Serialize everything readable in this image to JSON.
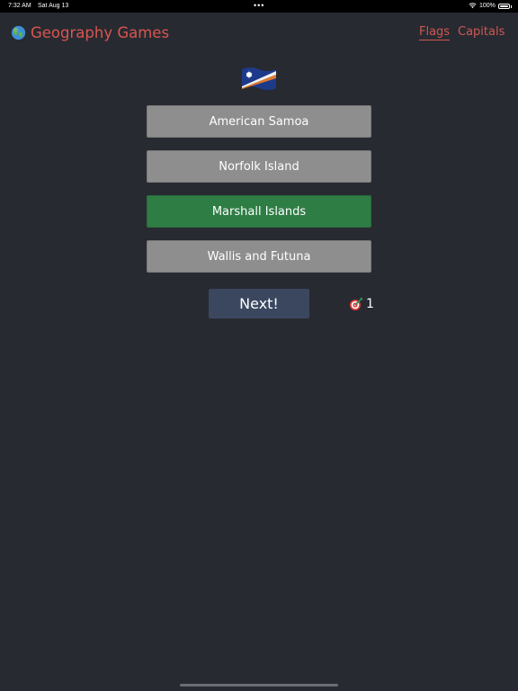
{
  "status_bar": {
    "time": "7:32 AM",
    "date": "Sat Aug 13",
    "battery": "100%",
    "icons": [
      "wifi-icon",
      "battery-icon"
    ]
  },
  "header": {
    "title": "Geography Games",
    "icon": "globe-icon",
    "nav": [
      {
        "label": "Flags",
        "active": true
      },
      {
        "label": "Capitals",
        "active": false
      }
    ]
  },
  "quiz": {
    "flag": "marshall-islands-flag-icon",
    "options": [
      {
        "label": "American Samoa",
        "state": "neutral"
      },
      {
        "label": "Norfolk Island",
        "state": "neutral"
      },
      {
        "label": "Marshall Islands",
        "state": "correct"
      },
      {
        "label": "Wallis and Futuna",
        "state": "neutral"
      }
    ],
    "next_label": "Next!",
    "score": "1",
    "score_icon": "target-icon"
  },
  "colors": {
    "background": "#282a31",
    "accent": "#d95550",
    "option": "#8e8e8e",
    "correct": "#2e7d45",
    "next": "#3a475f"
  }
}
